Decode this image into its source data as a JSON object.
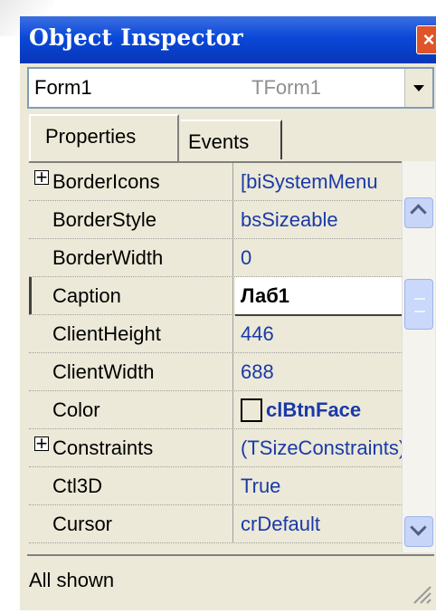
{
  "window": {
    "title": "Object Inspector"
  },
  "object_selector": {
    "name": "Form1",
    "type": "TForm1"
  },
  "tabs": [
    {
      "label": "Properties",
      "active": true
    },
    {
      "label": "Events",
      "active": false
    }
  ],
  "properties": [
    {
      "name": "BorderIcons",
      "value": "[biSystemMenu",
      "expandable": true
    },
    {
      "name": "BorderStyle",
      "value": "bsSizeable"
    },
    {
      "name": "BorderWidth",
      "value": "0"
    },
    {
      "name": "Caption",
      "value": "Лаб1",
      "selected": true
    },
    {
      "name": "ClientHeight",
      "value": "446"
    },
    {
      "name": "ClientWidth",
      "value": "688"
    },
    {
      "name": "Color",
      "value": "clBtnFace",
      "swatch": "#ece9d8"
    },
    {
      "name": "Constraints",
      "value": "(TSizeConstraints)",
      "expandable": true
    },
    {
      "name": "Ctl3D",
      "value": "True"
    },
    {
      "name": "Cursor",
      "value": "crDefault"
    }
  ],
  "status": {
    "text": "All shown"
  },
  "colors": {
    "titlebar": "#0a48d8",
    "value_text": "#1a3aa8",
    "close_button": "#e0542a"
  }
}
